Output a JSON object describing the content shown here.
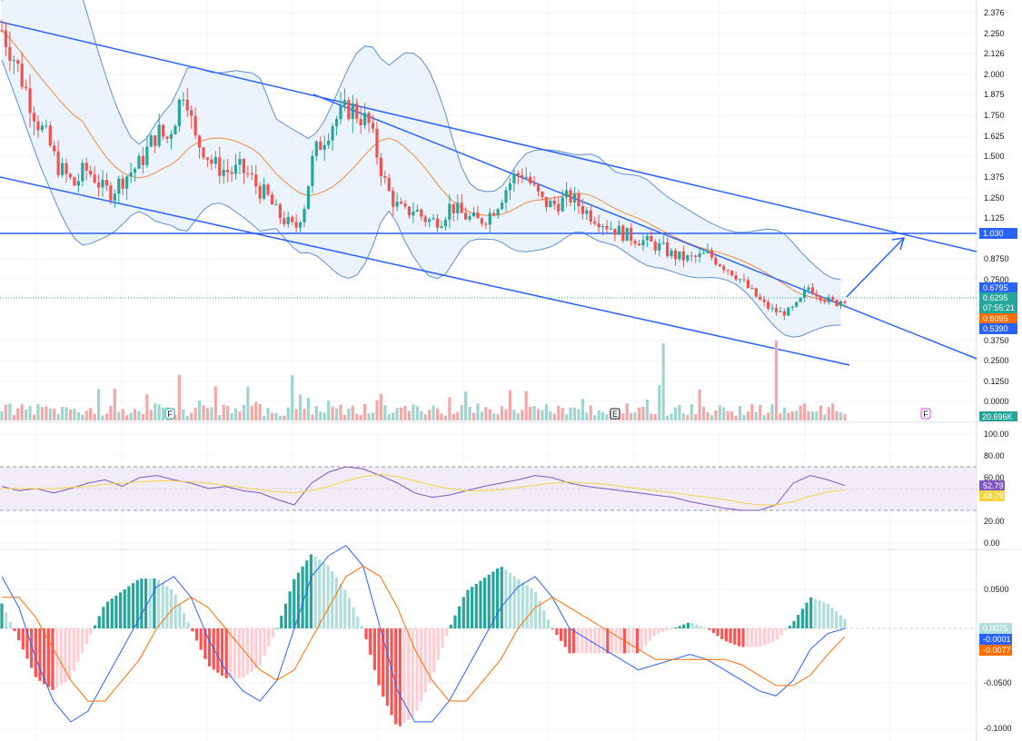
{
  "colors": {
    "up": "#26a69a",
    "down": "#ef5350",
    "up_volume": "#9fd5cf",
    "down_volume": "#f4a8a6",
    "trendline": "#2962ff",
    "bb_band": "#5b8fd6",
    "bb_fill": "#e3f0fb",
    "bb_basis": "#f7853e",
    "rsi_line": "#7e57c2",
    "rsi_ma": "#f5d442",
    "rsi_fill": "#ede7f6",
    "macd_line": "#2962ff",
    "signal_line": "#ff6d00",
    "hist_up_strong": "#26a69a",
    "hist_up_weak": "#b2dfdb",
    "hist_down_strong": "#ff5252",
    "hist_down_weak": "#ffcdd2",
    "grid": "#f0f3fa"
  },
  "chart_data": [
    {
      "type": "candlestick",
      "panel": "price",
      "y_ticks": [
        "2.376",
        "2.250",
        "2.126",
        "2.000",
        "1.875",
        "1.750",
        "1.625",
        "1.500",
        "1.375",
        "1.250",
        "1.125",
        "0.8750",
        "0.7500",
        "0.3750",
        "0.2500",
        "0.1250",
        "0.0000"
      ],
      "ylim": [
        0.0,
        2.376
      ],
      "grid": true,
      "overlays": [
        "Bollinger Bands",
        "Volume",
        "trend channel lines",
        "horizontal level 1.030",
        "projection arrow"
      ],
      "approx_close_path": [
        2.27,
        2.15,
        2.0,
        1.85,
        1.7,
        1.6,
        1.45,
        1.38,
        1.32,
        1.42,
        1.38,
        1.3,
        1.28,
        1.35,
        1.4,
        1.45,
        1.55,
        1.65,
        1.6,
        1.75,
        1.95,
        1.6,
        1.55,
        1.45,
        1.42,
        1.4,
        1.42,
        1.38,
        1.3,
        1.25,
        1.15,
        1.1,
        1.05,
        1.2,
        1.5,
        1.6,
        1.7,
        1.75,
        1.8,
        1.75,
        1.7,
        1.5,
        1.3,
        1.2,
        1.15,
        1.18,
        1.12,
        1.1,
        1.12,
        1.2,
        1.15,
        1.12,
        1.1,
        1.13,
        1.2,
        1.3,
        1.38,
        1.4,
        1.3,
        1.22,
        1.2,
        1.22,
        1.25,
        1.2,
        1.15,
        1.12,
        1.08,
        1.05,
        1.02,
        1.0,
        0.98,
        0.96,
        0.94,
        0.9,
        0.88,
        0.87,
        0.88,
        0.9,
        0.86,
        0.82,
        0.78,
        0.72,
        0.66,
        0.6,
        0.56,
        0.54,
        0.55,
        0.6,
        0.7,
        0.66,
        0.62,
        0.6,
        0.63
      ],
      "tags": [
        {
          "name": "level",
          "value": "1.030"
        },
        {
          "name": "bb_upper",
          "value": "0.6795"
        },
        {
          "name": "last_price",
          "value": "0.6295",
          "countdown": "07:55:21"
        },
        {
          "name": "bb_basis",
          "value": "0.6095"
        },
        {
          "name": "bb_lower",
          "value": "0.5390"
        }
      ],
      "volume_tag": "20.696K",
      "event_markers": [
        "F",
        "E",
        "F"
      ]
    },
    {
      "type": "line",
      "panel": "RSI",
      "y_ticks": [
        "100.00",
        "80.00",
        "60.00",
        "20.00",
        "0.00"
      ],
      "ylim": [
        0,
        100
      ],
      "bands": [
        30,
        70
      ],
      "series": [
        {
          "values": [
            52,
            48,
            50,
            46,
            50,
            55,
            58,
            52,
            60,
            62,
            58,
            55,
            50,
            52,
            48,
            46,
            40,
            35,
            55,
            65,
            70,
            68,
            62,
            55,
            46,
            42,
            44,
            48,
            52,
            55,
            58,
            62,
            60,
            55,
            52,
            50,
            48,
            46,
            44,
            42,
            38,
            35,
            32,
            30,
            30,
            35,
            55,
            62,
            58,
            52.79
          ]
        },
        {
          "values": [
            50,
            50,
            50,
            50,
            51,
            52,
            54,
            55,
            56,
            57,
            57,
            56,
            55,
            53,
            51,
            49,
            47,
            46,
            48,
            52,
            57,
            61,
            63,
            61,
            57,
            53,
            50,
            48,
            48,
            49,
            51,
            53,
            55,
            56,
            55,
            54,
            52,
            50,
            48,
            46,
            44,
            42,
            40,
            37,
            35,
            35,
            38,
            43,
            47,
            48.79
          ]
        }
      ],
      "tags": [
        "52.79",
        "48.79"
      ]
    },
    {
      "type": "line",
      "panel": "MACD",
      "y_ticks": [
        "0.0500",
        "-0.0500",
        "-0.1000"
      ],
      "ylim": [
        -0.105,
        0.07
      ],
      "series": [
        {
          "values": [
            0.05,
            0.02,
            -0.03,
            -0.07,
            -0.09,
            -0.08,
            -0.05,
            -0.02,
            0.01,
            0.04,
            0.05,
            0.03,
            -0.01,
            -0.04,
            -0.06,
            -0.07,
            -0.05,
            0.0,
            0.05,
            0.07,
            0.08,
            0.06,
            0.0,
            -0.06,
            -0.09,
            -0.09,
            -0.07,
            -0.04,
            -0.01,
            0.02,
            0.04,
            0.05,
            0.03,
            0.0,
            -0.01,
            -0.02,
            -0.03,
            -0.04,
            -0.035,
            -0.03,
            -0.025,
            -0.03,
            -0.04,
            -0.05,
            -0.06,
            -0.065,
            -0.05,
            -0.02,
            -0.005,
            -0.0001
          ]
        },
        {
          "values": [
            0.03,
            0.03,
            0.01,
            -0.02,
            -0.05,
            -0.07,
            -0.07,
            -0.05,
            -0.03,
            0.0,
            0.02,
            0.03,
            0.02,
            0.0,
            -0.02,
            -0.04,
            -0.05,
            -0.04,
            -0.01,
            0.02,
            0.05,
            0.06,
            0.05,
            0.02,
            -0.02,
            -0.05,
            -0.07,
            -0.07,
            -0.05,
            -0.03,
            0.0,
            0.02,
            0.03,
            0.02,
            0.01,
            0.0,
            -0.01,
            -0.02,
            -0.03,
            -0.03,
            -0.03,
            -0.03,
            -0.03,
            -0.035,
            -0.045,
            -0.055,
            -0.055,
            -0.045,
            -0.025,
            -0.0077
          ]
        }
      ],
      "histogram": [
        0.0075
      ],
      "tags": [
        "0.0075",
        "-0.0001",
        "-0.0077"
      ]
    }
  ]
}
